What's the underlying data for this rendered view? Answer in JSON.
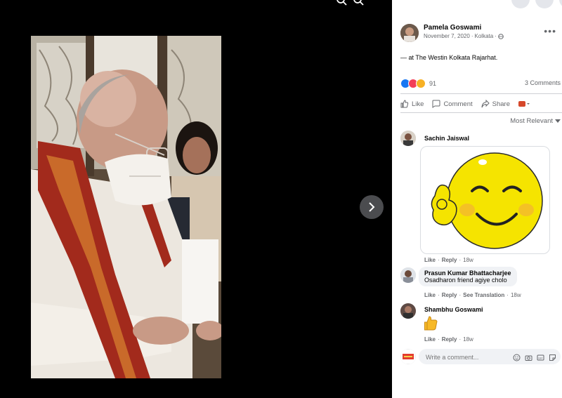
{
  "viewer": {
    "next_label": "›"
  },
  "post": {
    "author": "Pamela Goswami",
    "date": "November 7, 2020",
    "place": "Kolkata",
    "separator": " · ",
    "location_text": "— at The Westin Kolkata Rajarhat.",
    "reaction_count": "91",
    "comments_count": "3 Comments"
  },
  "actions": {
    "like": "Like",
    "comment": "Comment",
    "share": "Share"
  },
  "sort_label": "Most Relevant",
  "comments": [
    {
      "name": "Sachin Jaiswal",
      "like": "Like",
      "reply": "Reply",
      "time": "18w"
    },
    {
      "name": "Prasun Kumar Bhattacharjee",
      "text": "Osadharon friend agiye cholo",
      "like": "Like",
      "reply": "Reply",
      "translation": "See Translation",
      "time": "18w"
    },
    {
      "name": "Shambhu Goswami",
      "like": "Like",
      "reply": "Reply",
      "time": "18w"
    }
  ],
  "write_comment": {
    "placeholder": "Write a comment..."
  },
  "colors": {
    "accent": "#1877f2",
    "sticker_yellow": "#f5e400",
    "panel_bg": "#ffffff",
    "viewer_bg": "#000000"
  }
}
